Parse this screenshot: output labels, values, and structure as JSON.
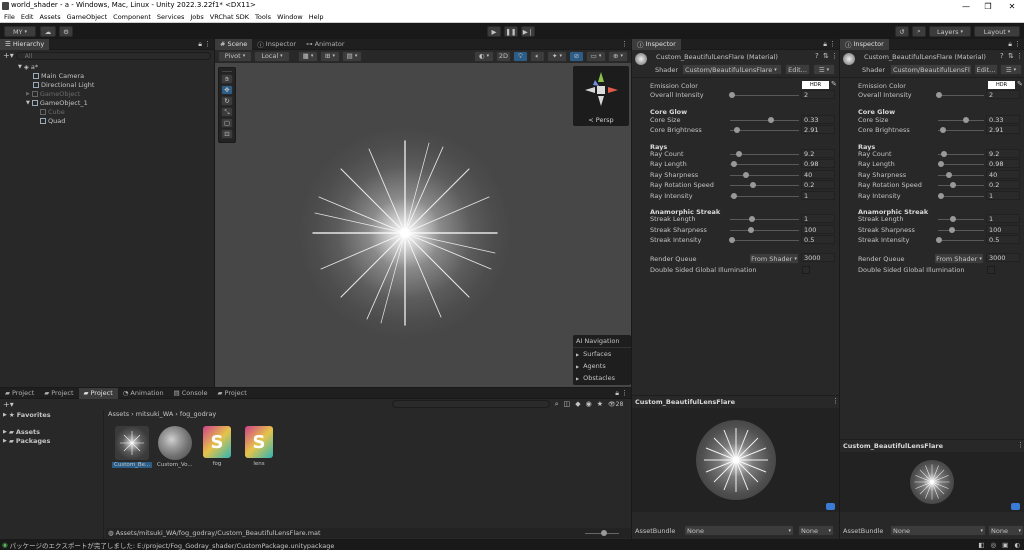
{
  "window": {
    "title": "world_shader - a - Windows, Mac, Linux - Unity 2022.3.22f1* <DX11>",
    "minimize": "—",
    "maximize": "❐",
    "close": "✕"
  },
  "menu": [
    "File",
    "Edit",
    "Assets",
    "GameObject",
    "Component",
    "Services",
    "Jobs",
    "VRChat SDK",
    "Tools",
    "Window",
    "Help"
  ],
  "toolbar": {
    "account": "MY",
    "layers": "Layers",
    "layout": "Layout"
  },
  "hierarchy": {
    "tab": "Hierarchy",
    "search_placeholder": "All",
    "scene": "a*",
    "items": [
      {
        "label": "Main Camera",
        "dim": false
      },
      {
        "label": "Directional Light",
        "dim": false
      },
      {
        "label": "GameObject",
        "dim": true
      },
      {
        "label": "GameObject_1",
        "dim": false
      },
      {
        "label": "Cube",
        "dim": true
      },
      {
        "label": "Quad",
        "dim": false
      }
    ]
  },
  "center_tabs": {
    "scene": "Scene",
    "inspector": "Inspector",
    "animator": "Animator"
  },
  "scene_toolbar": {
    "pivot": "Pivot",
    "local": "Local",
    "mode_2d": "2D"
  },
  "gizmo": {
    "label": "< Persp"
  },
  "ai_nav": {
    "title": "AI Navigation",
    "items": [
      "Surfaces",
      "Agents",
      "Obstacles"
    ]
  },
  "bottom_tabs": [
    "Project",
    "Project",
    "Project",
    "Animation",
    "Console",
    "Project"
  ],
  "project": {
    "favorites": "Favorites",
    "assets": "Assets",
    "packages": "Packages",
    "breadcrumb": [
      "Assets",
      "mitsuki_WA",
      "fog_godray"
    ],
    "items": [
      {
        "label": "Custom_Be...",
        "type": "material",
        "selected": true
      },
      {
        "label": "Custom_Vo...",
        "type": "material-noise",
        "selected": false
      },
      {
        "label": "fog",
        "type": "shader",
        "selected": false
      },
      {
        "label": "lens",
        "type": "shader",
        "selected": false
      }
    ],
    "path": "Assets/mitsuki_WA/fog_godray/Custom_BeautifulLensFlare.mat",
    "count": "28"
  },
  "status": {
    "message": "パッケージのエクスポートが完了しました: E:/project/Fog_Godray_shader/CustomPackage.unitypackage"
  },
  "inspector": {
    "tab": "Inspector",
    "material_name": "Custom_BeautifulLensFlare (Material)",
    "shader_label": "Shader",
    "shader_value_1": "Custom/BeautifulLensFlare",
    "shader_value_2": "Custom/BeautifulLensFl",
    "edit": "Edit...",
    "emission_color": "Emission Color",
    "hdr": "HDR",
    "overall_intensity": {
      "label": "Overall Intensity",
      "value": "2",
      "pos": 0.03
    },
    "core_glow": "Core Glow",
    "core_size": {
      "label": "Core Size",
      "value": "0.33",
      "pos": 0.6
    },
    "core_brightness": {
      "label": "Core Brightness",
      "value": "2.91",
      "pos": 0.1
    },
    "rays": "Rays",
    "ray_count": {
      "label": "Ray Count",
      "value": "9.2",
      "pos": 0.13
    },
    "ray_length": {
      "label": "Ray Length",
      "value": "0.98",
      "pos": 0.06
    },
    "ray_sharpness": {
      "label": "Ray Sharpness",
      "value": "40",
      "pos": 0.23
    },
    "ray_rotation_speed": {
      "label": "Ray Rotation Speed",
      "value": "0.2",
      "pos": 0.33
    },
    "ray_intensity": {
      "label": "Ray Intensity",
      "value": "1",
      "pos": 0.06
    },
    "anamorphic": "Anamorphic Streak",
    "streak_length": {
      "label": "Streak Length",
      "value": "1",
      "pos": 0.32
    },
    "streak_sharpness": {
      "label": "Streak Sharpness",
      "value": "100",
      "pos": 0.3
    },
    "streak_intensity": {
      "label": "Streak Intensity",
      "value": "0.5",
      "pos": 0.03
    },
    "render_queue": "Render Queue",
    "from_shader": "From Shader",
    "render_queue_value": "3000",
    "double_sided": "Double Sided Global Illumination",
    "preview_title": "Custom_BeautifulLensFlare",
    "asset_bundle": "AssetBundle",
    "none": "None"
  },
  "colors": {
    "accent": "#2c5d87",
    "shader_pink": "#cf3f8a",
    "shader_teal": "#2fb5b5"
  }
}
